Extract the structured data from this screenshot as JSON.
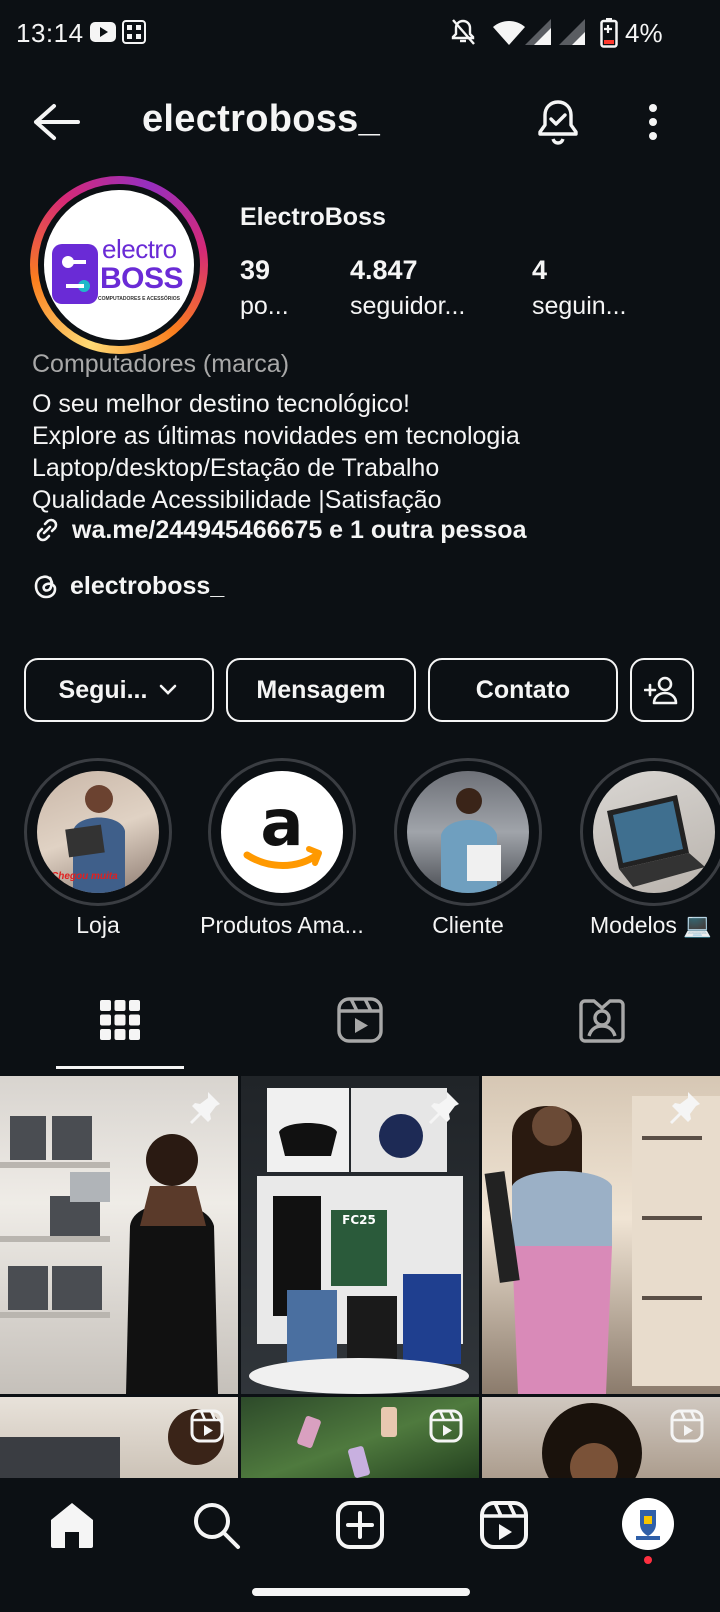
{
  "status_bar": {
    "time": "13:14",
    "battery": "4%"
  },
  "header": {
    "username": "electroboss_"
  },
  "profile": {
    "display_name": "ElectroBoss",
    "logo_text_top": "electro",
    "logo_text_bottom": "BOSS",
    "logo_tagline": "COMPUTADORES E ACESSÓRIOS",
    "stats": [
      {
        "value": "39",
        "label": "po..."
      },
      {
        "value": "4.847",
        "label": "seguidor..."
      },
      {
        "value": "4",
        "label": "seguin..."
      }
    ],
    "category": "Computadores (marca)",
    "bio": [
      "O seu melhor destino tecnológico!",
      "Explore as últimas novidades em tecnologia",
      "Laptop/desktop/Estação de Trabalho",
      "Qualidade Acessibilidade |Satisfação"
    ],
    "link": "wa.me/244945466675 e 1 outra pessoa",
    "threads": "electroboss_"
  },
  "actions": {
    "follow": "Segui...",
    "message": "Mensagem",
    "contact": "Contato"
  },
  "highlights": [
    {
      "label": "Loja",
      "caption": "Chegou muita"
    },
    {
      "label": "Produtos Ama..."
    },
    {
      "label": "Cliente"
    },
    {
      "label": "Modelos 💻"
    }
  ],
  "grid": {
    "post2_text": "FC25"
  },
  "colors": {
    "background": "#0c1014",
    "text": "#f5f5f5",
    "muted": "#a8a8a8",
    "brand_purple": "#6a2bd6",
    "brand_teal": "#1fb8c9"
  }
}
